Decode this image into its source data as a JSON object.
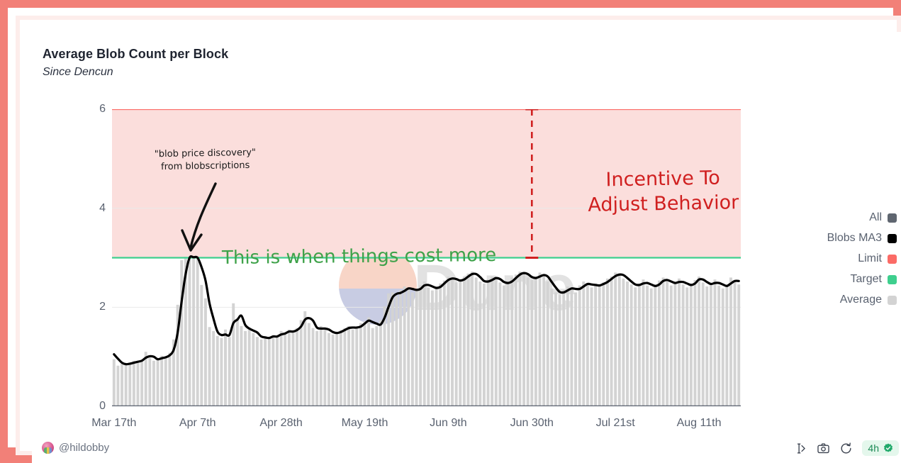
{
  "header": {
    "title": "Average Blob Count per Block",
    "subtitle": "Since Dencun"
  },
  "colors": {
    "outer_border": "#F28078",
    "inner_border": "#FDEDEB",
    "limit": "#FB6B66",
    "target": "#3ECF8E",
    "band_fill": "#FBDEDC",
    "bars_all": "#5F6670",
    "bars_average": "#D3D3D3",
    "ma3_line": "#000000",
    "annotation_green": "#3FA24A",
    "annotation_red": "#D02020",
    "badge_bg": "#E4F7EC",
    "badge_text": "#1C8A55"
  },
  "legend": {
    "items": [
      {
        "label": "All",
        "color": "#5F6670"
      },
      {
        "label": "Blobs MA3",
        "color": "#000000"
      },
      {
        "label": "Limit",
        "color": "#FB6B66"
      },
      {
        "label": "Target",
        "color": "#3ECF8E"
      },
      {
        "label": "Average",
        "color": "#D3D3D3"
      }
    ]
  },
  "annotations": [
    {
      "name": "blob-price-discovery",
      "line1": "\"blob price discovery\"",
      "line2": "from blobscriptions",
      "color": "#1A1A1A"
    },
    {
      "name": "cost-more",
      "text": "This is when things cost more",
      "color": "#3FA24A"
    },
    {
      "name": "incentive",
      "line1": "Incentive To",
      "line2": "Adjust Behavior",
      "color": "#D02020"
    }
  ],
  "watermark": {
    "text": "Dune"
  },
  "footer": {
    "handle": "@hildobby",
    "interval": "4h",
    "icons": [
      "embed-icon",
      "camera-icon",
      "reset-icon",
      "verified-icon"
    ]
  },
  "chart_data": {
    "type": "bar",
    "title": "Average Blob Count per Block",
    "subtitle": "Since Dencun",
    "xlabel": "",
    "ylabel": "",
    "ylim": [
      0,
      6
    ],
    "yticks": [
      0,
      2,
      4,
      6
    ],
    "grid": true,
    "legend_position": "right",
    "x_tick_labels": [
      "Mar 17th",
      "Apr 7th",
      "Apr 28th",
      "May 19th",
      "Jun 9th",
      "Jun 30th",
      "Jul 21st",
      "Aug 11th"
    ],
    "x_tick_indices": [
      0,
      21,
      42,
      63,
      84,
      105,
      126,
      147
    ],
    "reference_lines": [
      {
        "name": "Limit",
        "value": 6,
        "color": "#FB6B66"
      },
      {
        "name": "Target",
        "value": 3,
        "color": "#3ECF8E"
      }
    ],
    "shaded_band": {
      "from": 3,
      "to": 6,
      "color": "#FBDEDC",
      "label": "Incentive To Adjust Behavior"
    },
    "arrow_marker": {
      "x_index": 105,
      "from": 6,
      "to": 3,
      "style": "dashed-double-arrow",
      "color": "#D02020"
    },
    "series": [
      {
        "name": "All",
        "type": "bar",
        "color": "#D3D3D3",
        "values": [
          0.95,
          0.82,
          0.86,
          0.84,
          0.88,
          0.92,
          0.9,
          0.94,
          1.1,
          0.98,
          0.92,
          0.96,
          1.02,
          1.0,
          1.08,
          1.35,
          2.05,
          2.95,
          3.02,
          3.02,
          3.0,
          2.98,
          2.45,
          2.18,
          1.6,
          1.52,
          1.42,
          1.38,
          1.55,
          1.4,
          2.08,
          1.78,
          1.62,
          1.52,
          1.58,
          1.48,
          1.4,
          1.35,
          1.42,
          1.38,
          1.44,
          1.4,
          1.52,
          1.48,
          1.55,
          1.5,
          1.58,
          1.74,
          1.92,
          1.68,
          1.58,
          1.52,
          1.62,
          1.56,
          1.48,
          1.45,
          1.5,
          1.54,
          1.58,
          1.62,
          1.55,
          1.6,
          1.68,
          1.72,
          1.8,
          1.58,
          1.62,
          1.74,
          2.02,
          2.28,
          2.3,
          2.22,
          2.35,
          2.42,
          2.38,
          2.3,
          2.36,
          2.44,
          2.52,
          2.4,
          2.34,
          2.42,
          2.48,
          2.54,
          2.62,
          2.58,
          2.5,
          2.55,
          2.62,
          2.68,
          2.72,
          2.6,
          2.52,
          2.48,
          2.56,
          2.62,
          2.58,
          2.5,
          2.44,
          2.52,
          2.6,
          2.66,
          2.72,
          2.68,
          2.6,
          2.55,
          2.62,
          2.7,
          2.64,
          2.52,
          2.38,
          2.3,
          2.26,
          2.34,
          2.42,
          2.38,
          2.3,
          2.44,
          2.52,
          2.46,
          2.4,
          2.48,
          2.44,
          2.5,
          2.58,
          2.62,
          2.7,
          2.66,
          2.58,
          2.52,
          2.46,
          2.4,
          2.48,
          2.56,
          2.44,
          2.38,
          2.46,
          2.54,
          2.6,
          2.52,
          2.44,
          2.5,
          2.58,
          2.46,
          2.4,
          2.48,
          2.55,
          2.62,
          2.5,
          2.42,
          2.48,
          2.56,
          2.44,
          2.38,
          2.46,
          2.6,
          2.54,
          2.46
        ]
      },
      {
        "name": "Blobs MA3",
        "type": "line",
        "color": "#000000",
        "values": [
          1.05,
          0.96,
          0.88,
          0.85,
          0.86,
          0.88,
          0.9,
          0.92,
          0.98,
          1.01,
          1.0,
          0.95,
          0.97,
          0.99,
          1.03,
          1.14,
          1.49,
          2.12,
          2.67,
          3.0,
          3.01,
          3.0,
          2.81,
          2.54,
          2.08,
          1.77,
          1.51,
          1.44,
          1.45,
          1.44,
          1.68,
          1.75,
          1.83,
          1.64,
          1.57,
          1.53,
          1.49,
          1.41,
          1.39,
          1.38,
          1.41,
          1.41,
          1.45,
          1.47,
          1.51,
          1.51,
          1.54,
          1.61,
          1.75,
          1.78,
          1.73,
          1.59,
          1.57,
          1.57,
          1.55,
          1.5,
          1.48,
          1.5,
          1.54,
          1.58,
          1.59,
          1.59,
          1.61,
          1.67,
          1.73,
          1.7,
          1.67,
          1.65,
          1.79,
          2.01,
          2.2,
          2.27,
          2.29,
          2.33,
          2.38,
          2.37,
          2.35,
          2.37,
          2.44,
          2.45,
          2.42,
          2.39,
          2.41,
          2.48,
          2.55,
          2.58,
          2.57,
          2.54,
          2.56,
          2.62,
          2.67,
          2.67,
          2.61,
          2.53,
          2.52,
          2.55,
          2.59,
          2.57,
          2.51,
          2.49,
          2.52,
          2.59,
          2.66,
          2.69,
          2.67,
          2.61,
          2.59,
          2.62,
          2.65,
          2.62,
          2.51,
          2.4,
          2.31,
          2.3,
          2.34,
          2.38,
          2.37,
          2.37,
          2.42,
          2.47,
          2.46,
          2.45,
          2.44,
          2.47,
          2.51,
          2.57,
          2.63,
          2.66,
          2.65,
          2.59,
          2.52,
          2.46,
          2.45,
          2.48,
          2.49,
          2.46,
          2.43,
          2.46,
          2.53,
          2.55,
          2.52,
          2.49,
          2.51,
          2.51,
          2.48,
          2.45,
          2.48,
          2.56,
          2.56,
          2.51,
          2.47,
          2.49,
          2.49,
          2.46,
          2.43,
          2.48,
          2.53,
          2.53
        ]
      }
    ]
  }
}
